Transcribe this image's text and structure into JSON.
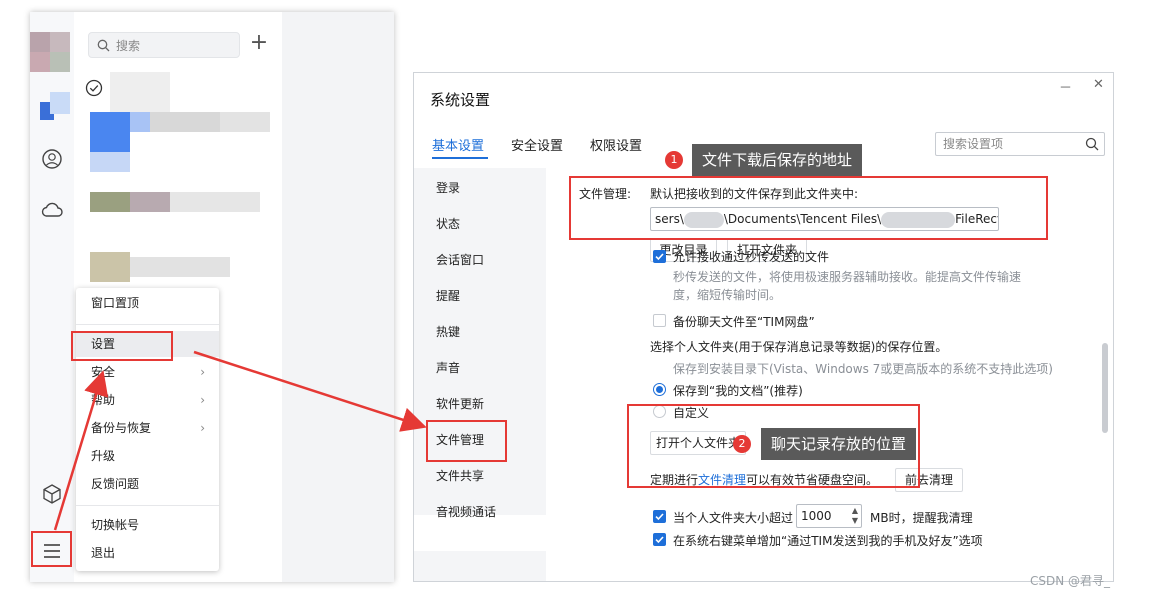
{
  "tim": {
    "search_placeholder": "搜索",
    "plus_label": "+",
    "icons": [
      "check-circle-icon",
      "smile-icon",
      "cloud-icon",
      "cube-icon",
      "hamburger-menu-icon"
    ]
  },
  "menu": {
    "items": [
      {
        "label": "窗口置顶",
        "submenu": false
      },
      {
        "label": "设置",
        "submenu": false,
        "highlighted": true
      },
      {
        "label": "安全",
        "submenu": true
      },
      {
        "label": "帮助",
        "submenu": true
      },
      {
        "label": "备份与恢复",
        "submenu": true
      },
      {
        "label": "升级",
        "submenu": false
      },
      {
        "label": "反馈问题",
        "submenu": false
      },
      {
        "label": "切换帐号",
        "submenu": false
      },
      {
        "label": "退出",
        "submenu": false
      }
    ],
    "arrow": "›"
  },
  "settings": {
    "title": "系统设置",
    "window_buttons": {
      "minimize": "－",
      "close": "✕"
    },
    "tabs": [
      {
        "label": "基本设置",
        "active": true
      },
      {
        "label": "安全设置",
        "active": false
      },
      {
        "label": "权限设置",
        "active": false
      }
    ],
    "search_placeholder": "搜索设置项",
    "sidebar": [
      {
        "label": "登录"
      },
      {
        "label": "状态"
      },
      {
        "label": "会话窗口"
      },
      {
        "label": "提醒"
      },
      {
        "label": "热键"
      },
      {
        "label": "声音"
      },
      {
        "label": "软件更新"
      },
      {
        "label": "文件管理",
        "active": true
      },
      {
        "label": "文件共享"
      },
      {
        "label": "音视频通话"
      }
    ],
    "file_mgmt": {
      "section_label": "文件管理:",
      "default_desc": "默认把接收到的文件保存到此文件夹中:",
      "path_part1": "sers\\",
      "path_part2": "\\Documents\\Tencent Files\\",
      "path_part3": "FileRecv\\",
      "change_dir_button": "更改目录",
      "open_folder_button": "打开文件夹",
      "allow_fast_label": "允许接收通过秒传发送的文件",
      "allow_fast_desc1": "秒传发送的文件，将使用极速服务器辅助接收。能提高文件传输速",
      "allow_fast_desc2": "度，缩短传输时间。",
      "backup_label": "备份聊天文件至“TIM网盘”",
      "personal_folder_desc": "选择个人文件夹(用于保存消息记录等数据)的保存位置。",
      "install_dir_note": "保存到安装目录下(Vista、Windows 7或更高版本的系统不支持此选项)",
      "my_docs_label": "保存到“我的文档”(推荐)",
      "custom_label": "自定义",
      "open_personal_button": "打开个人文件夹",
      "cleanup_prefix": "定期进行",
      "cleanup_link": "文件清理",
      "cleanup_suffix": "可以有效节省硬盘空间。",
      "cleanup_button": "前去清理",
      "size_prefix": "当个人文件夹大小超过",
      "size_value": "1000",
      "size_suffix": "MB时，提醒我清理",
      "context_menu_label": "在系统右键菜单增加“通过TIM发送到我的手机及好友”选项"
    }
  },
  "annotations": {
    "badge1": "1",
    "callout1": "文件下载后保存的地址",
    "badge2": "2",
    "callout2": "聊天记录存放的位置",
    "accent_color": "#e53935"
  },
  "watermark": "CSDN @君寻_",
  "colors": {
    "accent": "#1e6fd9",
    "annotation_red": "#e53935",
    "callout_bg": "#5a5a5a"
  }
}
